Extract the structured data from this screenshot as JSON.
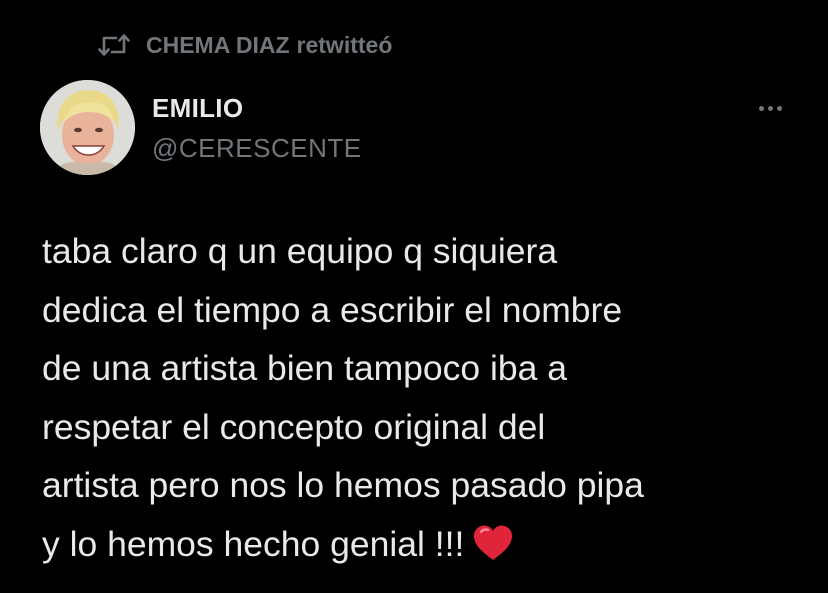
{
  "retweet": {
    "icon": "retweet-icon",
    "name": "CHEMA DIAZ",
    "verb": "retwitteó"
  },
  "author": {
    "avatar_icon": "avatar",
    "name": "EMILIO",
    "handle": "@CERESCENTE"
  },
  "more_button": {
    "icon": "more-dots-icon"
  },
  "tweet": {
    "text": "taba claro q un equipo q siquiera\ndedica el tiempo a escribir el nombre\nde una artista bien tampoco iba a\nrespetar el concepto original del\nartista pero nos lo hemos pasado pipa\ny lo hemos hecho genial !!!",
    "emoji_icon": "red-heart-icon"
  },
  "colors": {
    "background": "#000000",
    "primary_text": "#e7e9ea",
    "secondary_text": "#71767b",
    "heart": "#e0243a"
  }
}
